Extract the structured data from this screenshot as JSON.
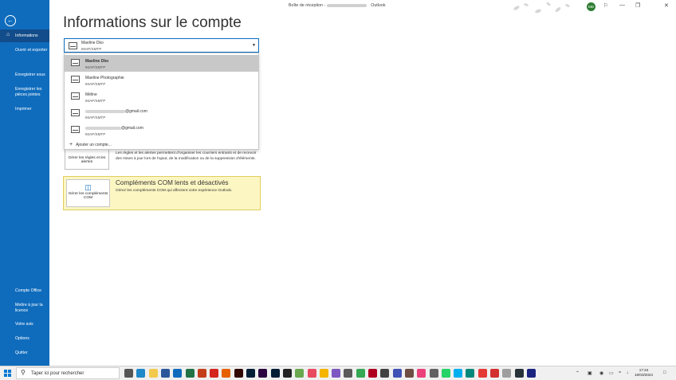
{
  "titlebar": {
    "prefix": "Boîte de réception -",
    "app": "Outlook",
    "avatar_initials": "MD",
    "controls": [
      "⚐",
      "—",
      "❐",
      "✕"
    ]
  },
  "sidebar": {
    "back_icon": "back-arrow-icon",
    "items": [
      {
        "label": "Informations",
        "icon": "home-icon"
      },
      {
        "label": "Ouvrir et exporter"
      },
      {
        "label": "Enregistrer sous"
      },
      {
        "label": "Enregistrer les pièces jointes"
      },
      {
        "label": "Imprimer"
      },
      {
        "label": "Compte Office"
      },
      {
        "label": "Mettre à jour la licence"
      },
      {
        "label": "Votre avis"
      },
      {
        "label": "Options"
      },
      {
        "label": "Quitter"
      }
    ]
  },
  "page": {
    "title": "Informations sur le compte"
  },
  "account_select": {
    "name": "Maeline Dko",
    "type": "IMAP/SMTP"
  },
  "dropdown": {
    "items": [
      {
        "name": "Maeline Dko",
        "type": "IMAP/SMTP"
      },
      {
        "name": "Maeline Photographie",
        "type": "IMAP/SMTP"
      },
      {
        "name": "Méline",
        "type": "IMAP/SMTP"
      },
      {
        "name": "@gmail.com",
        "type": "IMAP/SMTP"
      },
      {
        "name": "@gmail.com",
        "type": "IMAP/SMTP"
      }
    ],
    "add_account": "Ajouter un compte..."
  },
  "rules": {
    "button_label": "Gérer les règles et les alertes",
    "description": "Les règles et les alertes permettent d'organiser les courriers entrants et de recevoir des mises à jour lors de l'ajout, de la modification ou de la suppression d'éléments."
  },
  "com_addins": {
    "button_label": "Gérer les compléments COM",
    "title": "Compléments COM lents et désactivés",
    "description": "Gérez les compléments COM qui affectent votre expérience Outlook."
  },
  "taskbar": {
    "search_placeholder": "Taper ici pour rechercher",
    "time": "17:34",
    "date": "18/03/2024",
    "icons": [
      {
        "name": "task-view-icon",
        "color": "#555555"
      },
      {
        "name": "edge-icon",
        "color": "#1e88c8"
      },
      {
        "name": "file-explorer-icon",
        "color": "#f2c94c"
      },
      {
        "name": "word-icon",
        "color": "#2b579a"
      },
      {
        "name": "outlook-icon",
        "color": "#0f6cbd"
      },
      {
        "name": "excel-icon",
        "color": "#217346"
      },
      {
        "name": "powerpoint-icon",
        "color": "#c43e1c"
      },
      {
        "name": "acrobat-icon",
        "color": "#d4251f"
      },
      {
        "name": "firefox-icon",
        "color": "#e66000"
      },
      {
        "name": "illustrator-icon",
        "color": "#300700"
      },
      {
        "name": "lightroom-icon",
        "color": "#001e36"
      },
      {
        "name": "premiere-icon",
        "color": "#2a0040"
      },
      {
        "name": "photoshop-icon",
        "color": "#001e36"
      },
      {
        "name": "affinity-icon",
        "color": "#222222"
      },
      {
        "name": "minecraft-icon",
        "color": "#6aa84f"
      },
      {
        "name": "app-s-icon",
        "color": "#e84a5f"
      },
      {
        "name": "app-orange-icon",
        "color": "#f4b400"
      },
      {
        "name": "paint-icon",
        "color": "#7e57c2"
      },
      {
        "name": "xbox-icon",
        "color": "#5a5a5a"
      },
      {
        "name": "app-green-icon",
        "color": "#34a853"
      },
      {
        "name": "app-red-icon",
        "color": "#b00020"
      },
      {
        "name": "app-film-icon",
        "color": "#424242"
      },
      {
        "name": "app-blue-icon",
        "color": "#3f51b5"
      },
      {
        "name": "app-board-icon",
        "color": "#6d4c41"
      },
      {
        "name": "app-pink-icon",
        "color": "#ec407a"
      },
      {
        "name": "app-tools-icon",
        "color": "#616161"
      },
      {
        "name": "whatsapp-icon",
        "color": "#25d366"
      },
      {
        "name": "skype-icon",
        "color": "#00aff0"
      },
      {
        "name": "app-teal-icon",
        "color": "#00897b"
      },
      {
        "name": "app-arrow-icon",
        "color": "#e53935"
      },
      {
        "name": "app-cross-icon",
        "color": "#d32f2f"
      },
      {
        "name": "app-gray-icon",
        "color": "#9e9e9e"
      },
      {
        "name": "app-dark-icon",
        "color": "#263238"
      },
      {
        "name": "app-navy-icon",
        "color": "#1a237e"
      }
    ]
  }
}
